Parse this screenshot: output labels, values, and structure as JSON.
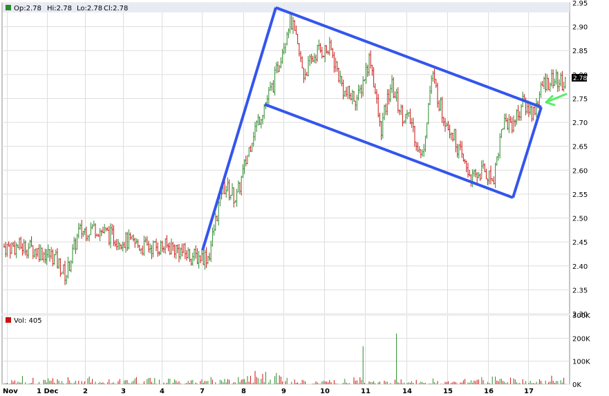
{
  "price_legend": {
    "open_label": "Op:2.78",
    "high_label": "Hi:2.78",
    "low_label": "Lo:2.78",
    "close_label": "Cl:2.78",
    "last_price": "2.78",
    "colors": {
      "up": "#2a8a2a",
      "down": "#cc1111",
      "last_badge": "#000000"
    }
  },
  "volume_legend": {
    "label": "Vol: 405"
  },
  "x_axis_labels": [
    "Nov",
    "1 Dec",
    "2",
    "3",
    "4",
    "7",
    "8",
    "9",
    "10",
    "11",
    "14",
    "15",
    "16",
    "17"
  ],
  "annotations": {
    "channel_color": "#3355ee",
    "arrow_color": "#55ee66"
  },
  "chart_data": [
    {
      "type": "candlestick",
      "title": "",
      "ylim": [
        2.3,
        2.95
      ],
      "y_ticks": [
        2.35,
        2.4,
        2.45,
        2.5,
        2.55,
        2.6,
        2.65,
        2.7,
        2.75,
        2.8,
        2.85,
        2.9,
        2.95
      ],
      "y_tick_labels": [
        "2.30",
        "2.35",
        "2.40",
        "2.45",
        "2.50",
        "2.55",
        "2.60",
        "2.65",
        "2.70",
        "2.75",
        "2.80",
        "2.85",
        "2.90",
        "2.95"
      ],
      "grid": true,
      "x_labels": [
        "Nov",
        "1 Dec",
        "2",
        "3",
        "4",
        "7",
        "8",
        "9",
        "10",
        "11",
        "14",
        "15",
        "16",
        "17"
      ],
      "session_close_path": [
        [
          "Nov",
          2.44
        ],
        [
          "1 Dec",
          2.42
        ],
        [
          "1 Dec",
          2.38
        ],
        [
          "1 Dec",
          2.47
        ],
        [
          "2",
          2.48
        ],
        [
          "2",
          2.46
        ],
        [
          "3",
          2.44
        ],
        [
          "4",
          2.44
        ],
        [
          "4",
          2.42
        ],
        [
          "7",
          2.42
        ],
        [
          "7",
          2.57
        ],
        [
          "7",
          2.54
        ],
        [
          "8",
          2.68
        ],
        [
          "8",
          2.78
        ],
        [
          "9",
          2.92
        ],
        [
          "9",
          2.8
        ],
        [
          "9",
          2.85
        ],
        [
          "10",
          2.85
        ],
        [
          "10",
          2.76
        ],
        [
          "10",
          2.75
        ],
        [
          "11",
          2.84
        ],
        [
          "11",
          2.68
        ],
        [
          "11",
          2.78
        ],
        [
          "11",
          2.72
        ],
        [
          "14",
          2.7
        ],
        [
          "14",
          2.62
        ],
        [
          "14",
          2.8
        ],
        [
          "14",
          2.72
        ],
        [
          "15",
          2.68
        ],
        [
          "15",
          2.62
        ],
        [
          "15",
          2.58
        ],
        [
          "15",
          2.6
        ],
        [
          "16",
          2.58
        ],
        [
          "16",
          2.7
        ],
        [
          "16",
          2.7
        ],
        [
          "16",
          2.74
        ],
        [
          "17",
          2.72
        ],
        [
          "17",
          2.78
        ],
        [
          "17",
          2.79
        ],
        [
          "17",
          2.78
        ]
      ],
      "last": 2.78
    },
    {
      "type": "bar",
      "title": "",
      "series": [
        {
          "name": "Vol",
          "last": 405
        }
      ],
      "ylim": [
        0,
        300000
      ],
      "y_ticks": [
        0,
        100000,
        200000,
        300000
      ],
      "y_tick_labels": [
        "0K",
        "100K",
        "200K",
        "300K"
      ],
      "x_labels": [
        "Nov",
        "1 Dec",
        "2",
        "3",
        "4",
        "7",
        "8",
        "9",
        "10",
        "11",
        "14",
        "15",
        "16",
        "17"
      ],
      "notable_values": {
        "max_spike_near_14": 220000,
        "spike_near_11": 165000
      }
    }
  ]
}
